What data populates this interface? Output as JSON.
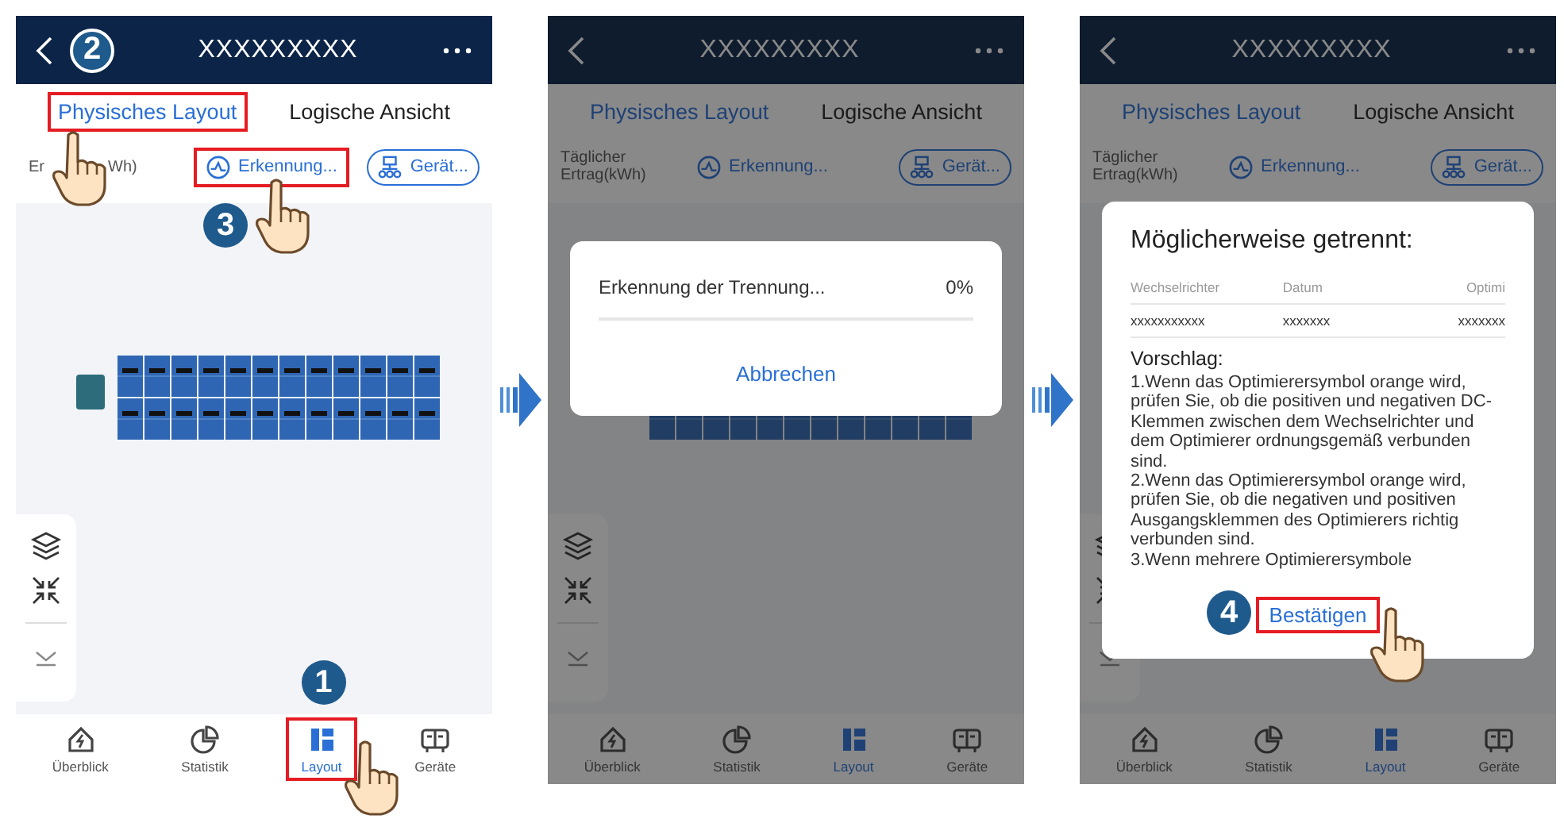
{
  "screens": [
    {
      "title": "XXXXXXXXX",
      "header_step": "2",
      "tabs": [
        {
          "label": "Physisches Layout",
          "selected": true,
          "highlighted": true
        },
        {
          "label": "Logische Ansicht",
          "selected": false,
          "highlighted": false
        }
      ],
      "yield_label": [
        "Er",
        "Wh)"
      ],
      "actions": [
        {
          "kind": "link",
          "label": "Erkennung...",
          "highlighted": true,
          "step": "3"
        },
        {
          "kind": "pill",
          "label": "Gerät...",
          "highlighted": false
        }
      ],
      "nav": [
        {
          "label": "Überblick",
          "selected": false,
          "highlighted": false
        },
        {
          "label": "Statistik",
          "selected": false,
          "highlighted": false
        },
        {
          "label": "Layout",
          "selected": true,
          "highlighted": true,
          "step": "1"
        },
        {
          "label": "Geräte",
          "selected": false,
          "highlighted": false
        }
      ]
    },
    {
      "title": "XXXXXXXXX",
      "tabs": [
        {
          "label": "Physisches Layout",
          "selected": true,
          "highlighted": false
        },
        {
          "label": "Logische Ansicht",
          "selected": false,
          "highlighted": false
        }
      ],
      "yield_label": [
        "Täglicher Ertrag(kWh)"
      ],
      "actions": [
        {
          "kind": "link",
          "label": "Erkennung...",
          "highlighted": false
        },
        {
          "kind": "pill",
          "label": "Gerät...",
          "highlighted": false
        }
      ],
      "nav": [
        {
          "label": "Überblick",
          "selected": false,
          "highlighted": false
        },
        {
          "label": "Statistik",
          "selected": false,
          "highlighted": false
        },
        {
          "label": "Layout",
          "selected": true,
          "highlighted": false
        },
        {
          "label": "Geräte",
          "selected": false,
          "highlighted": false
        }
      ],
      "dimmed": true,
      "dialog": {
        "kind": "progress",
        "text": "Erkennung der Trennung...",
        "percent": "0%",
        "level": 0,
        "button": "Abbrechen",
        "highlighted": false
      }
    },
    {
      "title": "XXXXXXXXX",
      "tabs": [
        {
          "label": "Physisches Layout",
          "selected": true,
          "highlighted": false
        },
        {
          "label": "Logische Ansicht",
          "selected": false,
          "highlighted": false
        }
      ],
      "yield_label": [
        "Täglicher Ertrag(kWh)"
      ],
      "actions": [
        {
          "kind": "link",
          "label": "Erkennung...",
          "highlighted": false
        },
        {
          "kind": "pill",
          "label": "Gerät...",
          "highlighted": false
        }
      ],
      "nav": [
        {
          "label": "Überblick",
          "selected": false,
          "highlighted": false
        },
        {
          "label": "Statistik",
          "selected": false,
          "highlighted": false
        },
        {
          "label": "Layout",
          "selected": true,
          "highlighted": false
        },
        {
          "label": "Geräte",
          "selected": false,
          "highlighted": false
        }
      ],
      "dimmed": true,
      "dialog": {
        "kind": "result",
        "title": "Möglicherweise getrennt:",
        "columns": [
          "Wechselrichter",
          "Datum",
          "Optimi"
        ],
        "row": [
          "xxxxxxxxxxx",
          "xxxxxxx",
          "xxxxxxx"
        ],
        "heading": "Vorschlag:",
        "paragraphs": [
          "1.Wenn das Optimierersymbol orange wird, prüfen Sie, ob die positiven und negativen DC-Klemmen zwischen dem Wechselrichter und dem Optimierer ordnungsgemäß verbunden sind.",
          "2.Wenn das Optimierersymbol orange wird, prüfen Sie, ob die negativen und positiven Ausgangsklemmen des Optimierers richtig verbunden sind.",
          "3.Wenn mehrere Optimierersymbole"
        ],
        "button": "Bestätigen",
        "highlighted": true,
        "step": "4"
      }
    }
  ]
}
